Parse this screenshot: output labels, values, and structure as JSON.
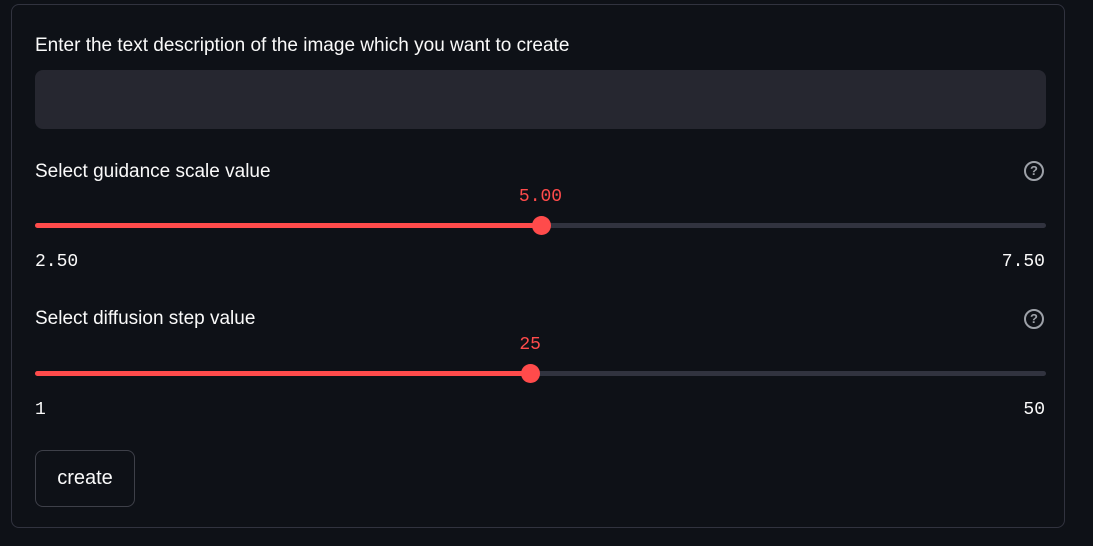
{
  "prompt": {
    "label": "Enter the text description of the image which you want to create",
    "value": "",
    "placeholder": ""
  },
  "guidance": {
    "label": "Select guidance scale value",
    "value": 5.0,
    "value_text": "5.00",
    "min": 2.5,
    "max": 7.5,
    "min_text": "2.50",
    "max_text": "7.50",
    "help_icon": "question-circle-icon"
  },
  "steps": {
    "label": "Select diffusion step value",
    "value": 25,
    "value_text": "25",
    "min": 1,
    "max": 50,
    "min_text": "1",
    "max_text": "50",
    "help_icon": "question-circle-icon"
  },
  "submit": {
    "label": "create"
  },
  "colors": {
    "background": "#0e1117",
    "accent": "#ff4b4b",
    "input_bg": "#262730",
    "border": "#31333f",
    "text": "#fafafa"
  }
}
